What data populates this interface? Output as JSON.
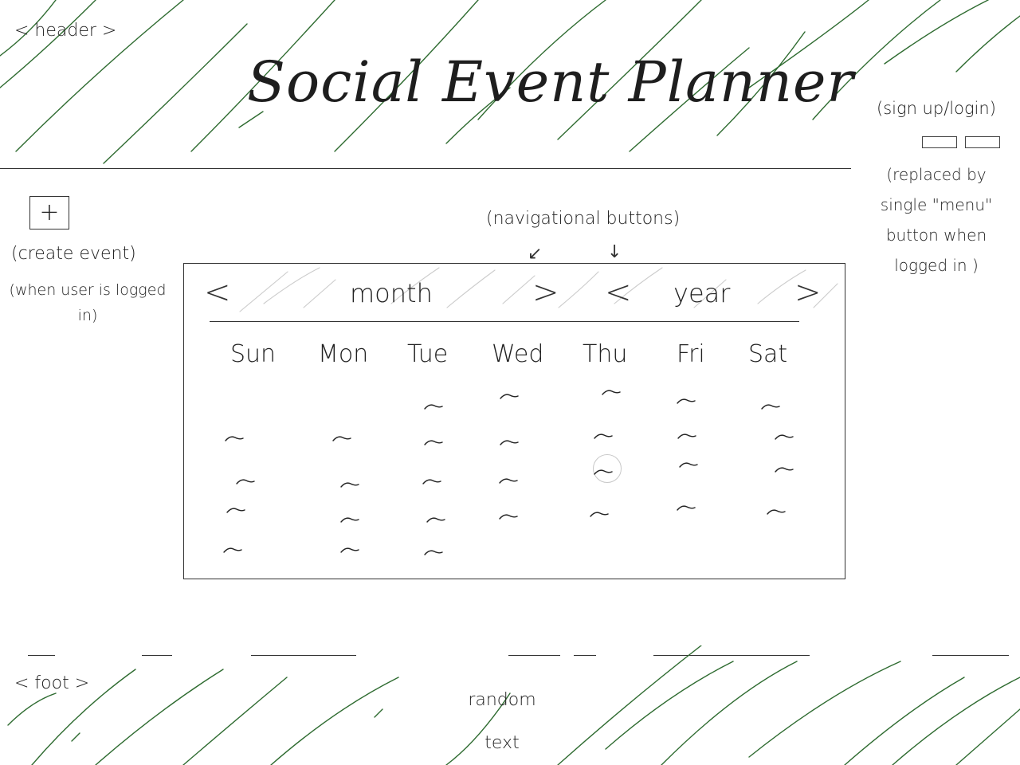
{
  "header": {
    "tag": "< header >",
    "title": "Social Event Planner",
    "auth_note": "(sign up/login)",
    "menu_note": "(replaced by single \"menu\" button when logged in )"
  },
  "create_event": {
    "button_label": "+",
    "note": "(create event)",
    "login_note": "(when user is logged in)"
  },
  "navigation": {
    "note": "(navigational buttons)",
    "prev_label": "<",
    "next_label": ">",
    "month_label": "month",
    "year_label": "year"
  },
  "calendar": {
    "weekdays": [
      "Sun",
      "Mon",
      "Tue",
      "Wed",
      "Thu",
      "Fri",
      "Sat"
    ],
    "day_placeholder": "~"
  },
  "footer": {
    "tag": "< foot >",
    "text": "random text"
  },
  "colors": {
    "scribble": "#2e6b30",
    "hatch": "#cccccc",
    "ink": "#222222"
  }
}
